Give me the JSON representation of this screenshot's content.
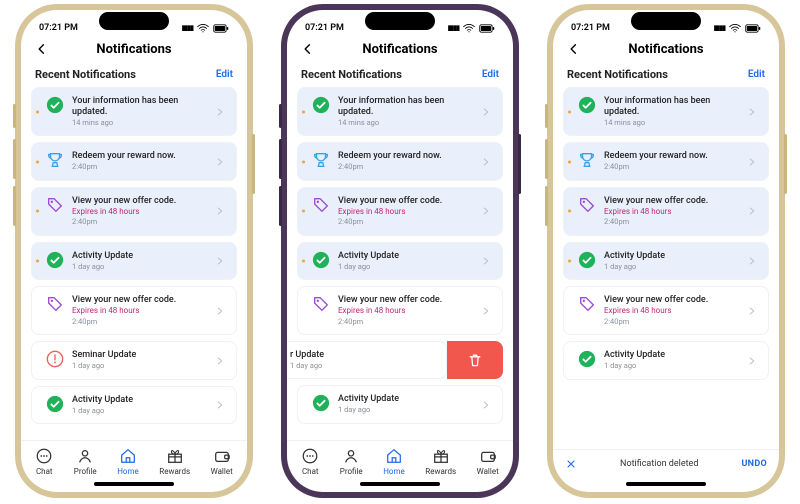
{
  "status": {
    "time": "07:21 PM"
  },
  "header": {
    "title": "Notifications"
  },
  "section": {
    "title": "Recent Notifications",
    "edit": "Edit"
  },
  "nav": {
    "chat": "Chat",
    "profile": "Profile",
    "home": "Home",
    "rewards": "Rewards",
    "wallet": "Wallet"
  },
  "items": [
    {
      "title": "Your information has been updated.",
      "time": "14 mins ago"
    },
    {
      "title": "Redeem your reward now.",
      "time": "2:40pm"
    },
    {
      "title": "View your new offer code.",
      "sub": "Expires in 48 hours",
      "time": "2:40pm"
    },
    {
      "title": "Activity Update",
      "time": "1 day ago"
    },
    {
      "title": "View your new offer code.",
      "sub": "Expires in 48 hours",
      "time": "2:40pm"
    },
    {
      "title": "Seminar Update",
      "time": "1 day ago"
    },
    {
      "title": "Activity Update",
      "time": "1 day ago"
    }
  ],
  "swipe": {
    "partial_title": "r Update",
    "time": "1 day ago"
  },
  "snackbar": {
    "msg": "Notification deleted",
    "undo": "UNDO"
  }
}
